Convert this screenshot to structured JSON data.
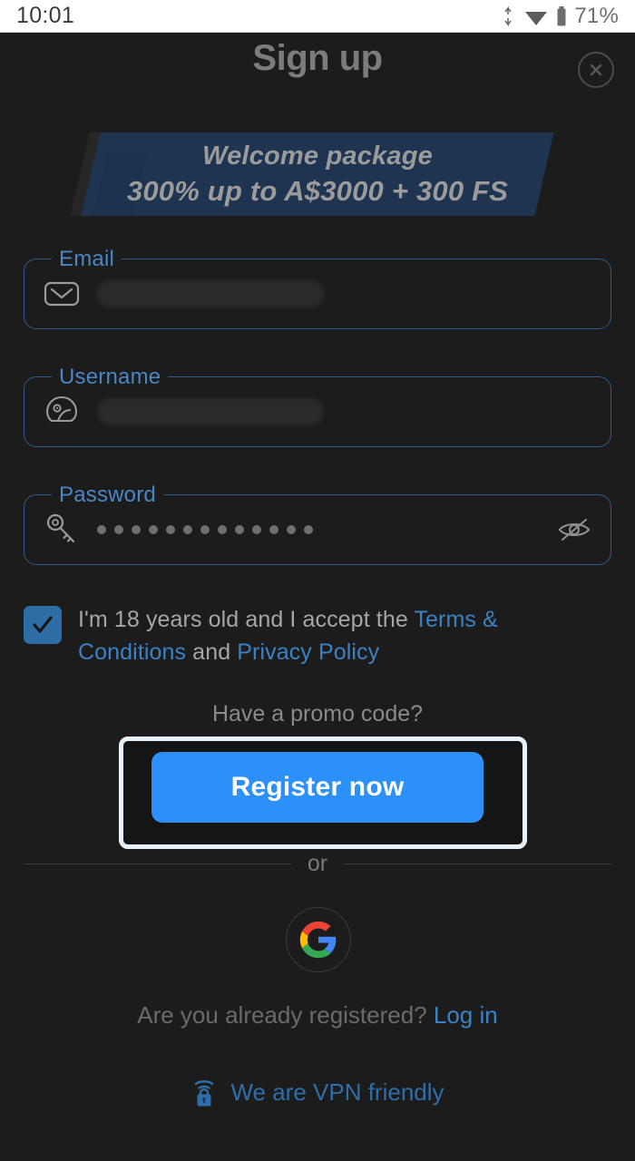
{
  "status_bar": {
    "time": "10:01",
    "battery_percent": "71%",
    "icons": [
      "data-transfer-icon",
      "wifi-icon",
      "battery-icon"
    ]
  },
  "header": {
    "title": "Sign up",
    "close_label": "×"
  },
  "banner": {
    "line1": "Welcome package",
    "line2": "300% up to A$3000 + 300 FS",
    "bg_color": "#1e3450",
    "text_color": "#9b9b9b"
  },
  "form": {
    "email": {
      "label": "Email",
      "value": "",
      "icon": "envelope-icon",
      "redacted": true
    },
    "username": {
      "label": "Username",
      "value": "",
      "icon": "helmet-icon",
      "redacted": true
    },
    "password": {
      "label": "Password",
      "value": "•••••••••••••",
      "dot_count": 13,
      "icon": "key-icon",
      "visibility_icon": "eye-off-icon",
      "visible": false
    }
  },
  "terms": {
    "checked": true,
    "text_before": "I'm 18 years old and I accept the ",
    "terms_link": "Terms & Conditions",
    "text_middle": " and ",
    "privacy_link": "Privacy Policy",
    "link_color": "#3b82c4"
  },
  "promo": {
    "label": "Have a promo code?"
  },
  "register": {
    "label": "Register now",
    "bg_color": "#2b90f7",
    "focused": true
  },
  "divider": {
    "label": "or"
  },
  "social": {
    "google_label": "Google",
    "icon": "google-g-icon"
  },
  "login": {
    "prompt": "Are you already registered?",
    "link": "Log in"
  },
  "vpn": {
    "label": "We are VPN friendly",
    "icon": "vpn-lock-icon",
    "color": "#2f6ea8"
  }
}
